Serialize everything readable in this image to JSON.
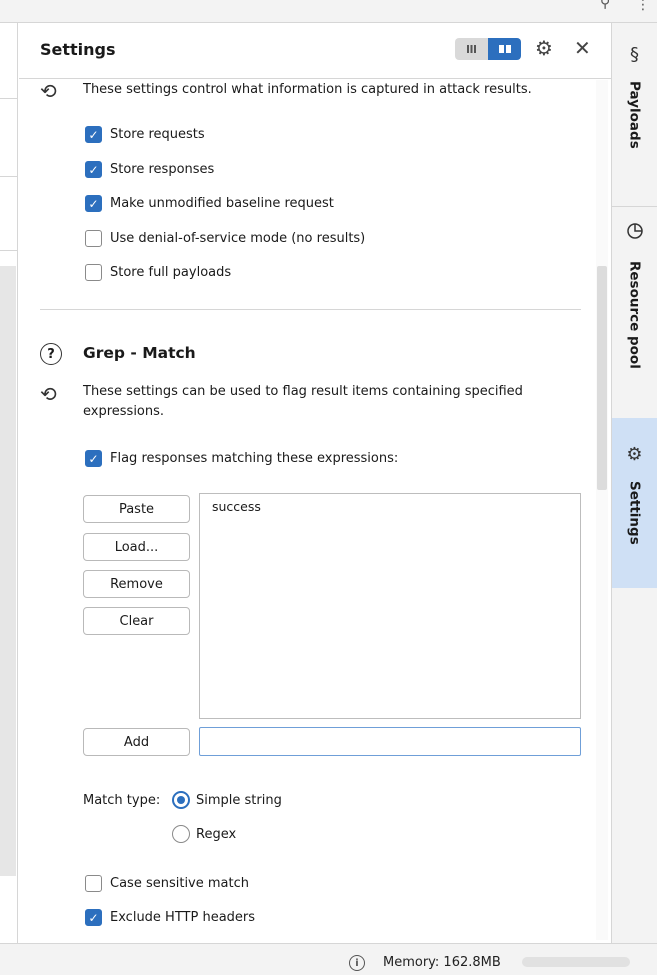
{
  "panel": {
    "title": "Settings",
    "toggle_left_icon": "list-view-icon",
    "toggle_right_icon": "split-view-icon",
    "settings_icon": "gear-icon",
    "close_icon": "close-icon"
  },
  "results": {
    "description": "These settings control what information is captured in attack results.",
    "options": [
      {
        "label": "Store requests",
        "checked": true
      },
      {
        "label": "Store responses",
        "checked": true
      },
      {
        "label": "Make unmodified baseline request",
        "checked": true
      },
      {
        "label": "Use denial-of-service mode (no results)",
        "checked": false
      },
      {
        "label": "Store full payloads",
        "checked": false
      }
    ]
  },
  "grep_match": {
    "title": "Grep - Match",
    "description_line1": "These settings can be used to flag result items containing specified",
    "description_line2": "expressions.",
    "flag_label": "Flag responses matching these expressions:",
    "flag_checked": true,
    "buttons": {
      "paste": "Paste",
      "load": "Load...",
      "remove": "Remove",
      "clear": "Clear",
      "add": "Add"
    },
    "expressions": [
      "success"
    ],
    "add_value": "",
    "match_type_label": "Match type:",
    "match_types": [
      {
        "label": "Simple string",
        "selected": true
      },
      {
        "label": "Regex",
        "selected": false
      }
    ],
    "case_sensitive_label": "Case sensitive match",
    "case_sensitive_checked": false,
    "exclude_headers_label": "Exclude HTTP headers",
    "exclude_headers_checked": true
  },
  "right_tabs": [
    {
      "label": "Payloads",
      "icon": "dollar-icon",
      "active": false
    },
    {
      "label": "Resource pool",
      "icon": "pie-chart-icon",
      "active": false
    },
    {
      "label": "Settings",
      "icon": "gear-icon",
      "active": true
    }
  ],
  "status_bar": {
    "info_icon": "info-icon",
    "memory_text": "Memory: 162.8MB"
  },
  "top_bar": {
    "search_icon": "search-icon",
    "menu_icon": "more-vertical-icon"
  },
  "colors": {
    "accent": "#2c6fbe",
    "active_tab": "#cfe0f5",
    "border": "#d6d6d6"
  }
}
